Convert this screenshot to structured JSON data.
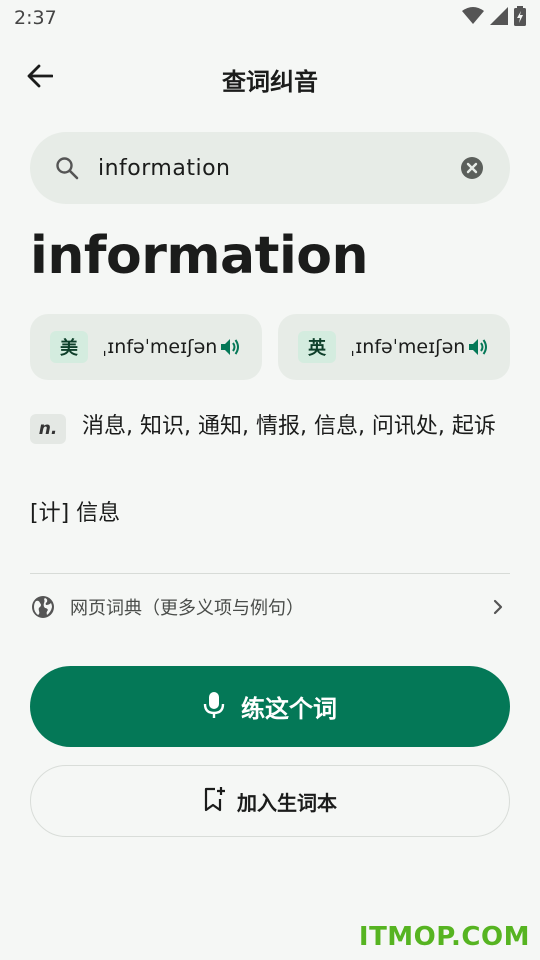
{
  "status_bar": {
    "time": "2:37"
  },
  "app_bar": {
    "title": "查词纠音"
  },
  "search": {
    "value": "information"
  },
  "word": {
    "headword": "information",
    "pronunciations": [
      {
        "region": "美",
        "ipa": "ˌɪnfəˈmeɪʃən"
      },
      {
        "region": "英",
        "ipa": "ˌɪnfəˈmeɪʃən"
      }
    ],
    "definitions": [
      {
        "pos": "n.",
        "text": "消息, 知识, 通知, 情报, 信息, 问讯处, 起诉"
      }
    ],
    "tech_definition": "[计] 信息"
  },
  "web_dict": {
    "label": "网页词典（更多义项与例句）"
  },
  "actions": {
    "practice_label": "练这个词",
    "add_label": "加入生词本"
  },
  "watermark": "ITMOP.COM",
  "colors": {
    "accent": "#047857",
    "badge_bg": "#d4ecdf",
    "surface": "#e7ece7"
  },
  "icons": [
    "wifi-icon",
    "signal-icon",
    "battery-icon",
    "back-arrow-icon",
    "search-icon",
    "clear-icon",
    "speaker-icon",
    "globe-icon",
    "chevron-right-icon",
    "mic-icon",
    "bookmark-add-icon"
  ]
}
